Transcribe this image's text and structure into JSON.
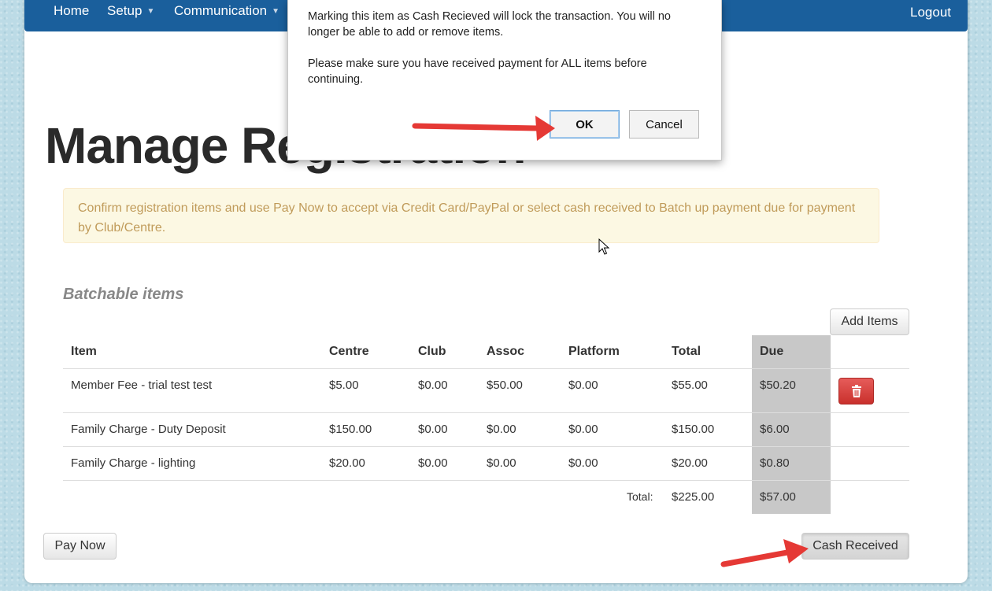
{
  "nav": {
    "home": "Home",
    "setup": "Setup",
    "communication": "Communication",
    "logout": "Logout"
  },
  "page": {
    "title": "Manage Registration",
    "alert": "Confirm registration items and use Pay Now to accept via Credit Card/PayPal or select cash received to Batch up payment due for payment by Club/Centre.",
    "section_title": "Batchable items",
    "add_items": "Add Items",
    "pay_now": "Pay Now",
    "cash_received": "Cash Received"
  },
  "table": {
    "headers": [
      "Item",
      "Centre",
      "Club",
      "Assoc",
      "Platform",
      "Total",
      "Due"
    ],
    "rows": [
      [
        "Member Fee - trial test test",
        "$5.00",
        "$0.00",
        "$50.00",
        "$0.00",
        "$55.00",
        "$50.20"
      ],
      [
        "Family Charge - Duty Deposit",
        "$150.00",
        "$0.00",
        "$0.00",
        "$0.00",
        "$150.00",
        "$6.00"
      ],
      [
        "Family Charge - lighting",
        "$20.00",
        "$0.00",
        "$0.00",
        "$0.00",
        "$20.00",
        "$0.80"
      ]
    ],
    "total_label": "Total:",
    "total_value": "$225.00",
    "total_due": "$57.00"
  },
  "dialog": {
    "message_1": "Marking this item as Cash Recieved will lock the transaction. You will no longer be able to add or remove items.",
    "message_2": "Please make sure you have received payment for ALL items before continuing.",
    "ok": "OK",
    "cancel": "Cancel"
  },
  "colors": {
    "navbar": "#1a5f9c",
    "delete_button": "#d9534f",
    "annotation_arrow": "#e53935",
    "due_column": "#c8c8c8"
  }
}
